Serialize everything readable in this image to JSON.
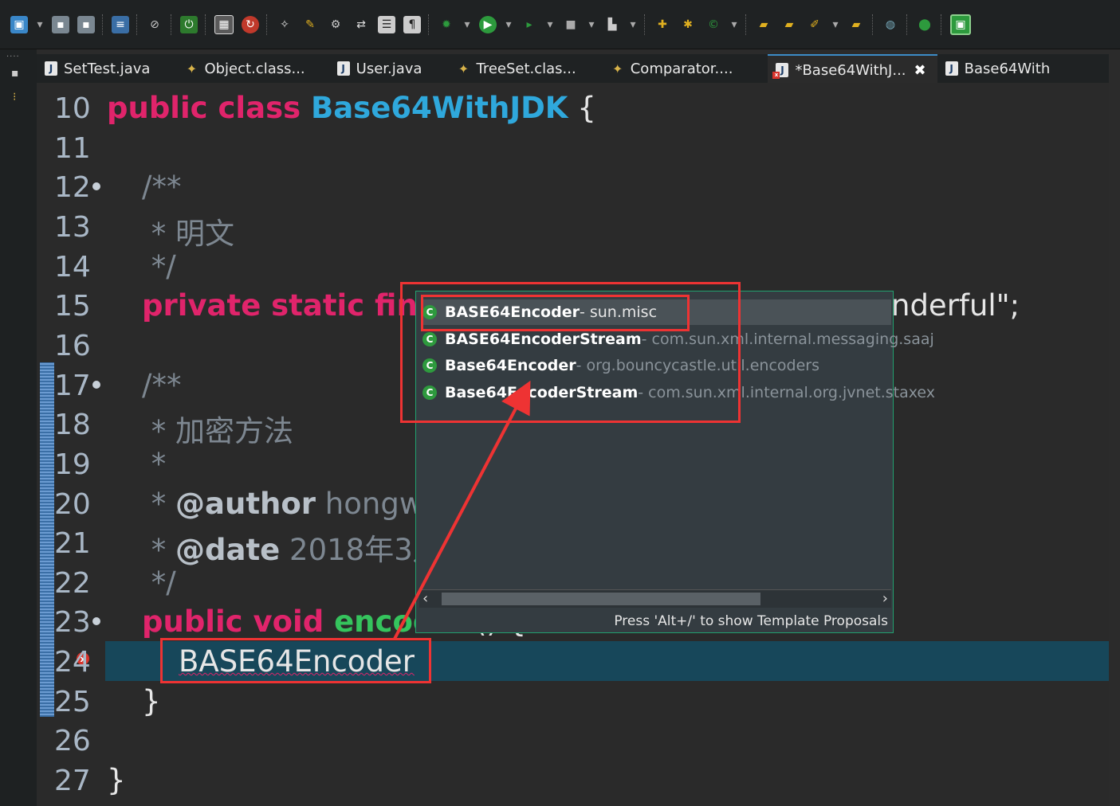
{
  "toolbar": {
    "icon_count": 36
  },
  "tabs": [
    {
      "label": "SetTest.java",
      "icon": "java-file-icon"
    },
    {
      "label": "Object.class...",
      "icon": "class-file-icon"
    },
    {
      "label": "User.java",
      "icon": "java-file-icon"
    },
    {
      "label": "TreeSet.clas...",
      "icon": "class-file-icon"
    },
    {
      "label": "Comparator....",
      "icon": "class-file-icon"
    },
    {
      "label": "*Base64WithJ...",
      "icon": "java-file-error-icon",
      "active": true
    },
    {
      "label": "Base64With",
      "icon": "java-file-icon"
    }
  ],
  "code": {
    "l10": {
      "num": "10",
      "kw": "public class ",
      "cls": "Base64WithJDK",
      "rest": " {"
    },
    "l11": {
      "num": "11"
    },
    "l12": {
      "num": "12",
      "text": "/**"
    },
    "l13": {
      "num": "13",
      "text": " * 明文"
    },
    "l14": {
      "num": "14",
      "text": " */"
    },
    "l15": {
      "num": "15",
      "kw": "private static fina",
      "rest": "nderful\";"
    },
    "l16": {
      "num": "16"
    },
    "l17": {
      "num": "17",
      "text": "/**"
    },
    "l18": {
      "num": "18",
      "text": " * 加密方法"
    },
    "l19": {
      "num": "19",
      "text": " *"
    },
    "l20": {
      "num": "20",
      "star": " * ",
      "tag": "@author",
      "rest": " hongw"
    },
    "l21": {
      "num": "21",
      "star": " * ",
      "tag": "@date",
      "rest": " 2018年3月"
    },
    "l22": {
      "num": "22",
      "text": " */"
    },
    "l23": {
      "num": "23",
      "kw": "public void ",
      "fn": "encod",
      "rest": "() {"
    },
    "l24": {
      "num": "24",
      "text": "BASE64Encoder"
    },
    "l25": {
      "num": "25",
      "text": "}"
    },
    "l26": {
      "num": "26"
    },
    "l27": {
      "num": "27",
      "text": "}"
    }
  },
  "popup": {
    "items": [
      {
        "name": "BASE64Encoder",
        "pkg": " - sun.misc",
        "selected": true
      },
      {
        "name": "BASE64EncoderStream",
        "pkg": " - com.sun.xml.internal.messaging.saaj"
      },
      {
        "name": "Base64Encoder",
        "pkg": " - org.bouncycastle.util.encoders"
      },
      {
        "name": "Base64EncoderStream",
        "pkg": " - com.sun.xml.internal.org.jvnet.staxex"
      }
    ],
    "status": "Press 'Alt+/' to show Template Proposals"
  }
}
